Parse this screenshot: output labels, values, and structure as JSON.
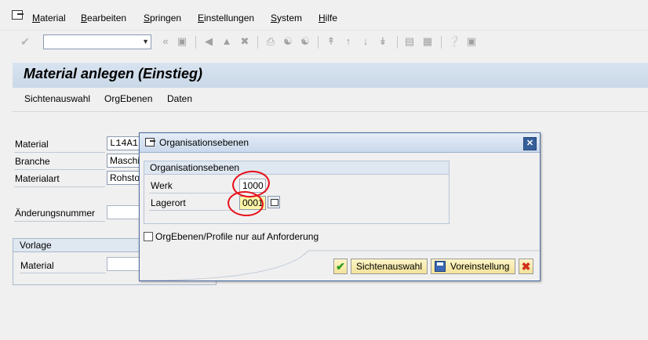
{
  "menu": {
    "items": [
      "Material",
      "Bearbeiten",
      "Springen",
      "Einstellungen",
      "System",
      "Hilfe"
    ],
    "underline_chars": [
      "M",
      "B",
      "S",
      "E",
      "S",
      "H"
    ]
  },
  "toolbar": {
    "icons": [
      "check-icon",
      "back-icon",
      "save-icon",
      "back-nav-icon",
      "exit-icon",
      "cancel-icon",
      "print-icon",
      "find-icon",
      "find-next-icon",
      "first-page-icon",
      "prev-page-icon",
      "next-page-icon",
      "last-page-icon",
      "new-session-icon",
      "shortcut-icon",
      "help-icon",
      "layout-icon"
    ]
  },
  "page": {
    "title": "Material anlegen (Einstieg)",
    "app_buttons": [
      "Sichtenauswahl",
      "OrgEbenen",
      "Daten"
    ]
  },
  "form": {
    "material_label": "Material",
    "material_value": "L14A1",
    "branche_label": "Branche",
    "branche_value": "Maschi",
    "materialart_label": "Materialart",
    "materialart_value": "Rohsto",
    "aenderung_label": "Änderungsnummer",
    "vorlage_title": "Vorlage",
    "vorlage_material_label": "Material"
  },
  "dialog": {
    "title": "Organisationsebenen",
    "group_title": "Organisationsebenen",
    "werk_label": "Werk",
    "werk_value": "1000",
    "lagerort_label": "Lagerort",
    "lagerort_value": "0001",
    "checkbox_label": "OrgEbenen/Profile nur auf Anforderung",
    "checkbox_checked": false,
    "btn_sichten": "Sichtenauswahl",
    "btn_voreinstellung": "Voreinstellung"
  },
  "colors": {
    "annotation": "#e8101a",
    "title_bg": "#c9d8e8",
    "button_bg": "#f2e39a"
  }
}
